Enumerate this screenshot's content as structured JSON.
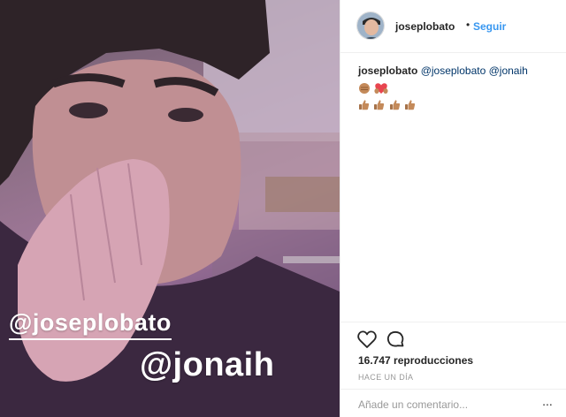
{
  "post": {
    "media": {
      "overlay_tag_1": "@joseplobato",
      "overlay_tag_2": "@jonaih"
    },
    "header": {
      "username": "joseplobato",
      "separator": "•",
      "follow_label": "Seguir"
    },
    "caption": {
      "username": "joseplobato",
      "mention_1": "@joseplobato",
      "mention_2": "@jonaih",
      "emoji_line_1": [
        "fist-bump-emoji",
        "heart-hands-emoji"
      ],
      "emoji_line_2": [
        "thumbs-up-emoji",
        "thumbs-up-emoji",
        "thumbs-up-emoji",
        "thumbs-up-emoji"
      ]
    },
    "actions": [
      "heart-icon",
      "comment-icon"
    ],
    "views_text": "16.747 reproducciones",
    "time_text": "HACE UN DÍA",
    "comment": {
      "placeholder": "Añade un comentario...",
      "more_label": "..."
    }
  }
}
